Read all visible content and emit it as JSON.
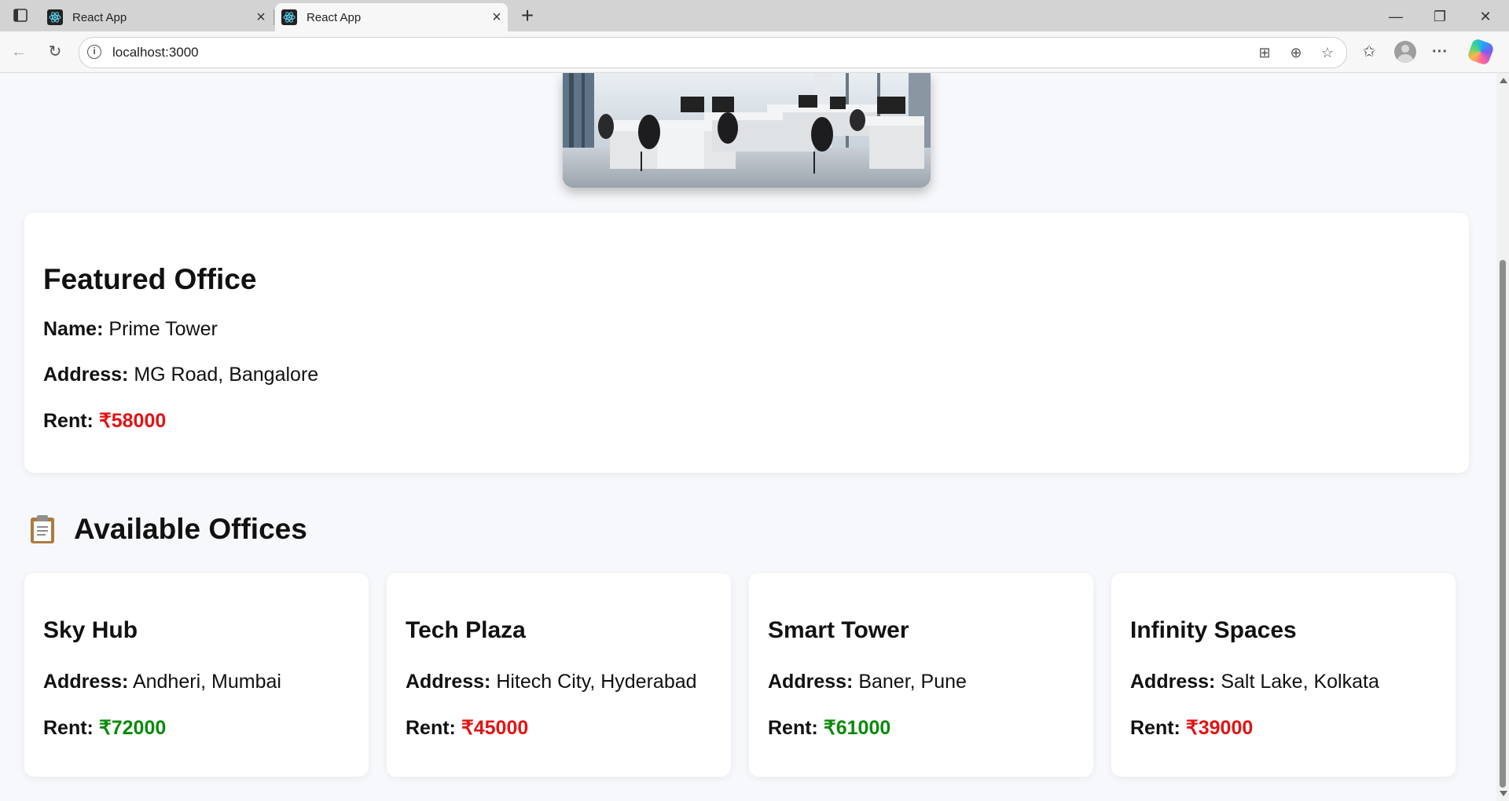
{
  "browser": {
    "tabs": [
      {
        "title": "React App"
      },
      {
        "title": "React App",
        "active": true
      }
    ],
    "address": "localhost:3000"
  },
  "page": {
    "featured": {
      "heading": "Featured Office",
      "name_label": "Name:",
      "name": "Prime Tower",
      "address_label": "Address:",
      "address": "MG Road, Bangalore",
      "rent_label": "Rent:",
      "rent": "₹58000",
      "rent_color": "#e31313"
    },
    "list_heading": "Available Offices",
    "list_icon": "clipboard-icon",
    "offices": [
      {
        "name": "Sky Hub",
        "address": "Andheri, Mumbai",
        "rent": "₹72000",
        "rent_color": "#0a8a0a"
      },
      {
        "name": "Tech Plaza",
        "address": "Hitech City, Hyderabad",
        "rent": "₹45000",
        "rent_color": "#e31313"
      },
      {
        "name": "Smart Tower",
        "address": "Baner, Pune",
        "rent": "₹61000",
        "rent_color": "#0a8a0a"
      },
      {
        "name": "Infinity Spaces",
        "address": "Salt Lake, Kolkata",
        "rent": "₹39000",
        "rent_color": "#e31313"
      }
    ],
    "labels": {
      "address": "Address:",
      "rent": "Rent:"
    }
  }
}
